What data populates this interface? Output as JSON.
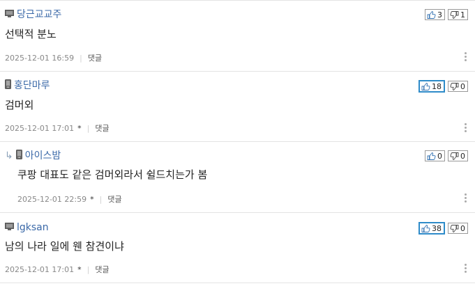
{
  "comments": [
    {
      "device": "pc-icon",
      "author": "당근교교주",
      "text": "선택적 분노",
      "date": "2025-12-01 16:59",
      "mobile_mark": "",
      "reply_label": "댓글",
      "likes": "3",
      "dislikes": "1",
      "likes_highlighted": false,
      "indent": false
    },
    {
      "device": "mobile-icon",
      "author": "홍단마루",
      "text": "검머외",
      "date": "2025-12-01 17:01",
      "mobile_mark": "*",
      "reply_label": "댓글",
      "likes": "18",
      "dislikes": "0",
      "likes_highlighted": true,
      "indent": false
    },
    {
      "device": "mobile-icon",
      "author": "아이스밤",
      "text": "쿠팡 대표도 같은 검머외라서 쉴드치는가 봄",
      "date": "2025-12-01 22:59",
      "mobile_mark": "*",
      "reply_label": "댓글",
      "likes": "0",
      "dislikes": "0",
      "likes_highlighted": false,
      "indent": true
    },
    {
      "device": "pc-icon",
      "author": "lgksan",
      "text": "남의 나라 일에 웬 참견이냐",
      "date": "2025-12-01 17:01",
      "mobile_mark": "*",
      "reply_label": "댓글",
      "likes": "38",
      "dislikes": "0",
      "likes_highlighted": true,
      "indent": false
    }
  ],
  "colors": {
    "author": "#3b69a8",
    "highlight_border": "#2e8bc9",
    "separator": "#e3e3e3"
  }
}
